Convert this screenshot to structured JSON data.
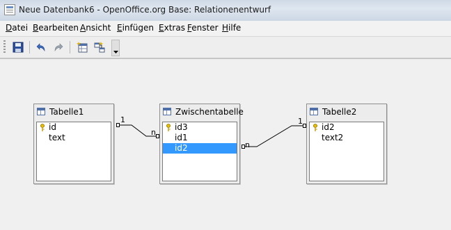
{
  "window": {
    "title": "Neue Datenbank6 - OpenOffice.org Base: Relationenentwurf"
  },
  "menu": [
    "Datei",
    "Bearbeiten",
    "Ansicht",
    "Einfügen",
    "Extras",
    "Fenster",
    "Hilfe"
  ],
  "toolbar": {
    "icons": [
      "save-icon",
      "undo-icon",
      "redo-icon",
      "add-table-icon",
      "new-relation-icon",
      "toolbar-overflow-icon"
    ]
  },
  "tables": [
    {
      "name": "Tabelle1",
      "fields": [
        {
          "name": "id",
          "key": true
        },
        {
          "name": "text",
          "key": false
        }
      ]
    },
    {
      "name": "Zwischentabelle",
      "fields": [
        {
          "name": "id3",
          "key": true
        },
        {
          "name": "id1",
          "key": false
        },
        {
          "name": "id2",
          "key": false,
          "selected": true
        }
      ]
    },
    {
      "name": "Tabelle2",
      "fields": [
        {
          "name": "id2",
          "key": true
        },
        {
          "name": "text2",
          "key": false
        }
      ]
    }
  ],
  "relations": [
    {
      "from": "Tabelle1",
      "to": "Zwischentabelle",
      "from_card": "1",
      "to_card": "n"
    },
    {
      "from": "Tabelle2",
      "to": "Zwischentabelle",
      "from_card": "1",
      "to_card": "n"
    }
  ],
  "colors": {
    "selection": "#3399ff",
    "key": "#d4a800"
  }
}
